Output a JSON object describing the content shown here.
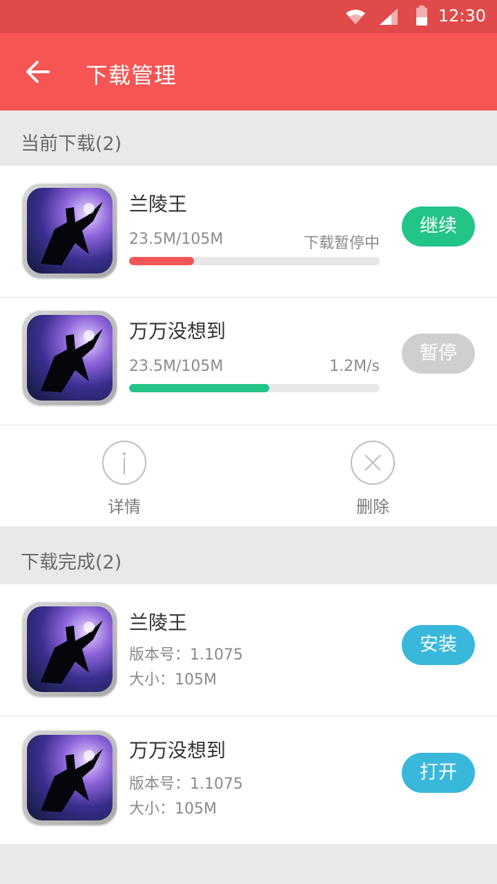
{
  "status_bar": {
    "time": "12:30"
  },
  "app_bar": {
    "title": "下载管理"
  },
  "current_section": {
    "title": "当前下载(2)"
  },
  "current_downloads": [
    {
      "name": "兰陵王",
      "size_progress": "23.5M/105M",
      "status": "下载暂停中",
      "progress_fraction": 0.26,
      "progress_color": "#f55555",
      "button_label": "继续",
      "button_color": "#23c488"
    },
    {
      "name": "万万没想到",
      "size_progress": "23.5M/105M",
      "status": "1.2M/s",
      "progress_fraction": 0.56,
      "progress_color": "#23c488",
      "button_label": "暂停",
      "button_color": "#cfcfcf"
    }
  ],
  "actions": {
    "details_label": "详情",
    "delete_label": "删除"
  },
  "completed_section": {
    "title": "下载完成(2)"
  },
  "completed_downloads": [
    {
      "name": "兰陵王",
      "version": "版本号：1.1075",
      "size": "大小：105M",
      "button_label": "安装",
      "button_color": "#3ab8dc"
    },
    {
      "name": "万万没想到",
      "version": "版本号：1.1075",
      "size": "大小：105M",
      "button_label": "打开",
      "button_color": "#3ab8dc"
    }
  ],
  "colors": {
    "status_bar": "#e04a4a",
    "app_bar": "#f75454",
    "background": "#e9e9e9"
  },
  "icons": [
    "wifi-icon",
    "signal-icon",
    "battery-icon",
    "back-arrow-icon",
    "info-icon",
    "close-icon",
    "app-icon"
  ]
}
